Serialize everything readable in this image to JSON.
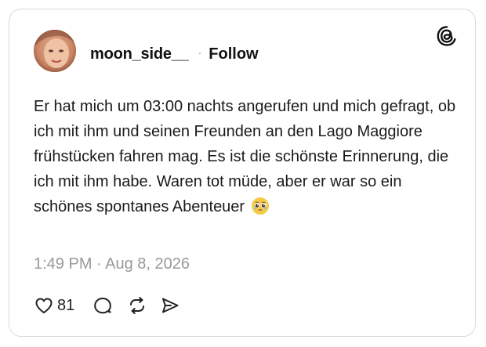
{
  "post": {
    "username": "moon_side__",
    "separator": "·",
    "follow_label": "Follow",
    "text": "Er hat mich um 03:00 nachts angerufen und mich gefragt, ob ich mit ihm und seinen Freunden an den Lago Maggiore frühstücken fahren mag. Es ist die schönste Erinnerung, die ich mit ihm habe. Waren tot müde, aber er war so ein schönes spontanes Abenteuer",
    "emoji": "🥹",
    "timestamp": "1:49 PM · Aug 8, 2026"
  },
  "actions": {
    "like_count": "81",
    "icons": [
      "heart-icon",
      "comment-icon",
      "repost-icon",
      "share-icon"
    ]
  },
  "branding": {
    "logo_icon": "threads-logo-icon"
  },
  "colors": {
    "text": "#1a1a1a",
    "muted": "#9a9a9a",
    "border": "#d9d9d9"
  }
}
